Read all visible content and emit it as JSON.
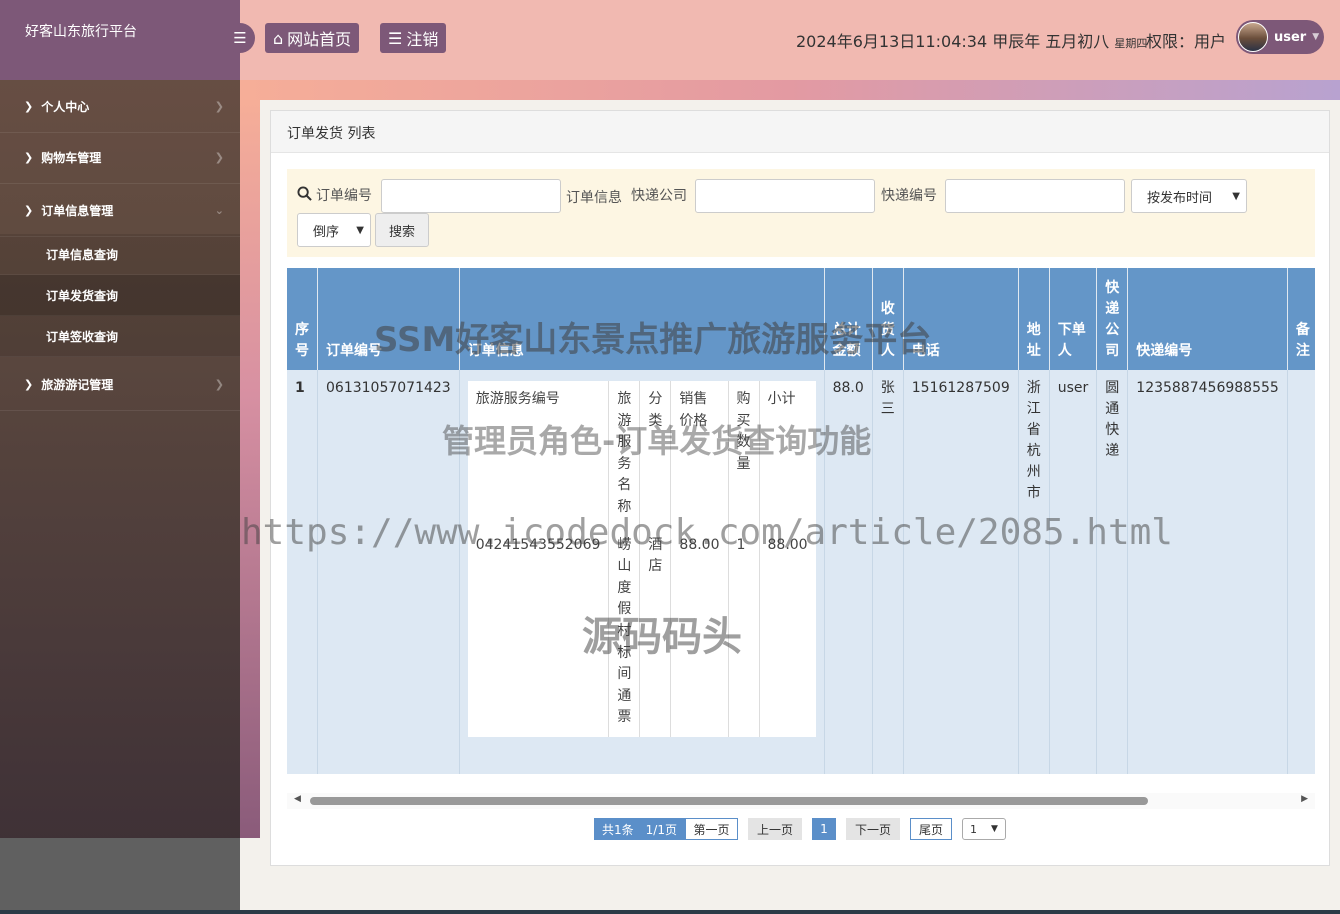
{
  "sidebar": {
    "brand": "好客山东旅行平台",
    "items": [
      {
        "label": "个人中心"
      },
      {
        "label": "购物车管理"
      },
      {
        "label": "订单信息管理"
      },
      {
        "label": "旅游游记管理"
      }
    ],
    "subitems": [
      {
        "label": "订单信息查询"
      },
      {
        "label": "订单发货查询"
      },
      {
        "label": "订单签收查询"
      }
    ]
  },
  "header": {
    "home_label": "网站首页",
    "logout_label": "注销",
    "datetime": "2024年6月13日11:04:34 甲辰年 五月初八",
    "weekday": "星期四",
    "permission": "权限：用户",
    "username": "user"
  },
  "panel": {
    "title": "订单发货 列表"
  },
  "search": {
    "order_no_label": "订单编号",
    "order_info_label": "订单信息",
    "courier_label": "快递公司",
    "tracking_label": "快递编号",
    "sort_select": "按发布时间",
    "order_select": "倒序",
    "button": "搜索"
  },
  "table": {
    "headers": {
      "index": "序号",
      "order_no": "订单编号",
      "order_info": "订单信息",
      "total": "总计金额",
      "receiver": "收货人",
      "phone": "电话",
      "address": "地址",
      "buyer": "下单人",
      "courier": "快递公司",
      "tracking": "快递编号",
      "remark": "备注"
    },
    "rows": [
      {
        "index": "1",
        "order_no": "06131057071423",
        "total": "88.0",
        "receiver": "张三",
        "phone": "15161287509",
        "address": "浙江省杭州市",
        "buyer": "user",
        "courier": "圆通快递",
        "tracking": "1235887456988555",
        "remark": "",
        "order_info": {
          "headers": {
            "service_no": "旅游服务编号",
            "service_name": "旅游服务名称",
            "category": "分类",
            "price": "销售价格",
            "qty": "购买数量",
            "subtotal": "小计"
          },
          "items": [
            {
              "service_no": "04241543552069",
              "service_name": "崂山度假村标间通票",
              "category": "酒店",
              "price": "88.00",
              "qty": "1",
              "subtotal": "88.00"
            }
          ]
        }
      }
    ]
  },
  "pager": {
    "summary": "共1条　1/1页",
    "first": "第一页",
    "prev": "上一页",
    "current": "1",
    "next": "下一页",
    "last": "尾页",
    "jump": "1"
  },
  "watermarks": {
    "title": "SSM好客山东景点推广旅游服务平台",
    "subtitle": "管理员角色-订单发货查询功能",
    "url": "https://www.icodedock.com/article/2085.html",
    "source": "源码码头"
  }
}
